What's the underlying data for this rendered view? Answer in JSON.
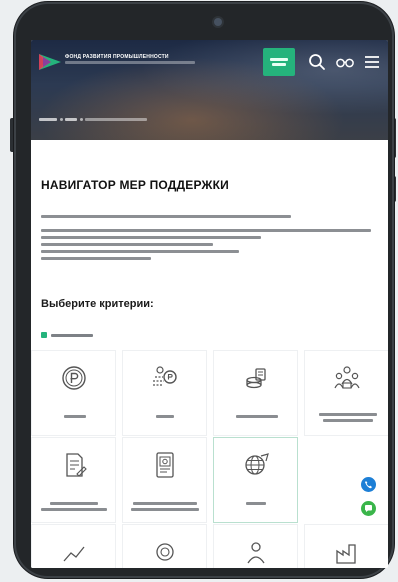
{
  "header": {
    "logo_line1": "ФОНД РАЗВИТИЯ ПРОМЫШЛЕННОСТИ",
    "accent_color": "#25b37c",
    "icons": [
      "search-icon",
      "low-vision-glasses-icon",
      "hamburger-menu-icon"
    ]
  },
  "page": {
    "title": "НАВИГАТОР МЕР ПОДДЕРЖКИ",
    "criteria_heading": "Выберите критерии:"
  },
  "criteria": {
    "cards": [
      {
        "icon": "ruble-coin-icon"
      },
      {
        "icon": "loan-coins-icon"
      },
      {
        "icon": "coin-stack-icon"
      },
      {
        "icon": "people-money-icon"
      },
      {
        "icon": "document-invest-icon"
      },
      {
        "icon": "tablet-document-icon"
      },
      {
        "icon": "globe-export-icon",
        "active": true
      }
    ]
  },
  "floating": {
    "phone_color": "#1d7fd6",
    "chat_color": "#3ab54a"
  }
}
